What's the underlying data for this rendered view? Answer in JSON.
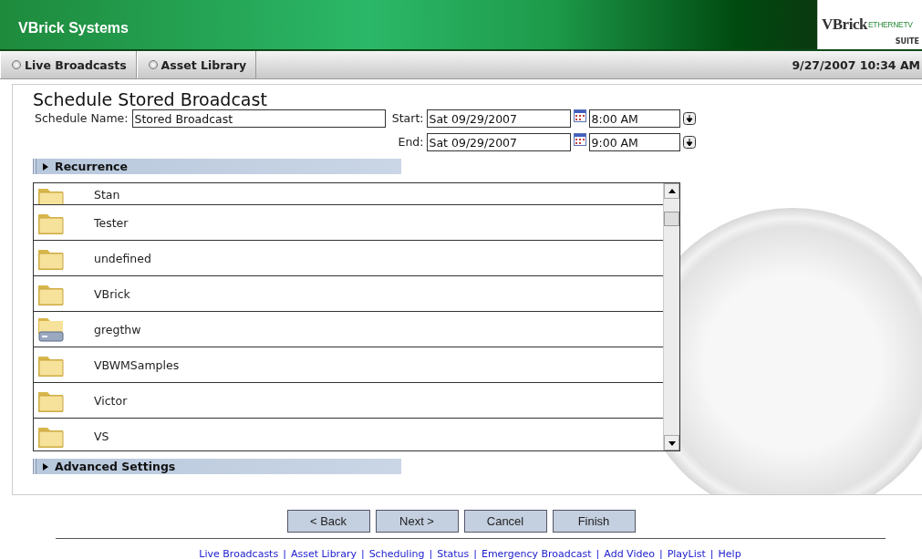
{
  "header": {
    "title": "VBrick Systems",
    "logo": {
      "brand": "VBrick",
      "product": "ETHERNETV",
      "suffix": "SUITE"
    }
  },
  "nav": {
    "tabs": [
      {
        "label": "Live Broadcasts",
        "selected": false
      },
      {
        "label": "Asset Library",
        "selected": false
      }
    ],
    "datetime": "9/27/2007 10:34 AM"
  },
  "form": {
    "title": "Schedule Stored Broadcast",
    "name_label": "Schedule Name:",
    "name_value": "Stored Broadcast",
    "start_label": "Start:",
    "start_date": "Sat 09/29/2007",
    "start_time": "8:00 AM",
    "end_label": "End:",
    "end_date": "Sat 09/29/2007",
    "end_time": "9:00 AM"
  },
  "sections": [
    {
      "label": "Recurrence",
      "expanded": false
    },
    {
      "label": "Advanced Settings",
      "expanded": false
    }
  ],
  "folders": [
    {
      "name": "Stan",
      "kind": "folder"
    },
    {
      "name": "Tester",
      "kind": "folder"
    },
    {
      "name": "undefined",
      "kind": "folder"
    },
    {
      "name": "VBrick",
      "kind": "folder"
    },
    {
      "name": "gregthw",
      "kind": "drive"
    },
    {
      "name": "VBWMSamples",
      "kind": "folder"
    },
    {
      "name": "Victor",
      "kind": "folder"
    },
    {
      "name": "VS",
      "kind": "folder"
    }
  ],
  "buttons": [
    "< Back",
    "Next >",
    "Cancel",
    "Finish"
  ],
  "footer": {
    "separator": "|",
    "links": [
      "Live Broadcasts",
      "Asset Library",
      "Scheduling",
      "Status",
      "Emergency Broadcast",
      "Add Video",
      "PlayList",
      "Help"
    ]
  }
}
